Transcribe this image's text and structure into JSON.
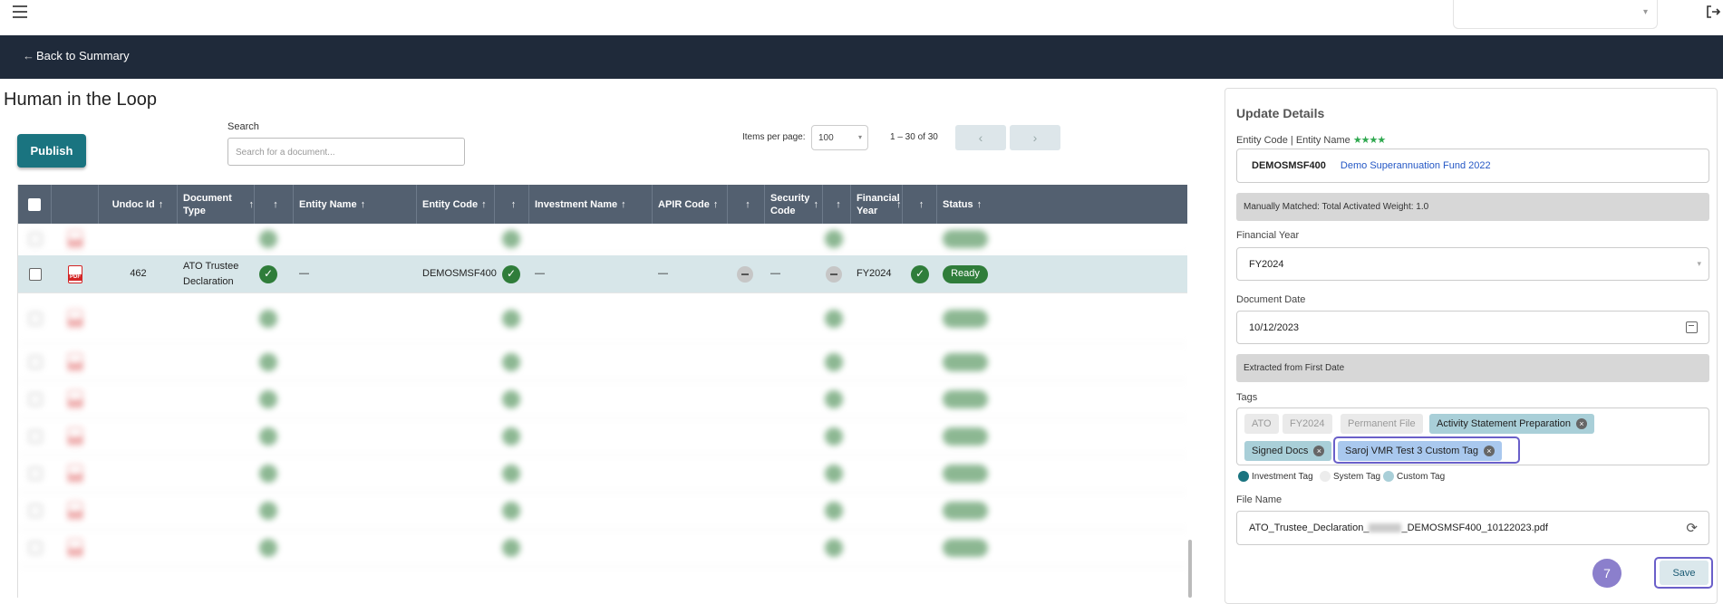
{
  "header": {
    "menu_icon": "hamburger-icon",
    "logout_icon": "logout-icon"
  },
  "nav": {
    "back_label": "Back to Summary"
  },
  "page": {
    "title": "Human in the Loop"
  },
  "toolbar": {
    "publish_label": "Publish",
    "search_label": "Search",
    "search_placeholder": "Search for a document...",
    "items_per_page_label": "Items per page:",
    "items_per_page_value": "100",
    "range_text": "1 – 30 of 30",
    "prev_icon": "‹",
    "next_icon": "›"
  },
  "table": {
    "columns": {
      "undoc_id": "Undoc Id",
      "document_type": "Document Type",
      "entity_name": "Entity Name",
      "entity_code": "Entity Code",
      "investment_name": "Investment Name",
      "apir_code": "APIR Code",
      "security_code": "Security Code",
      "financial_year": "Financial Year",
      "status": "Status"
    },
    "sort_arrow": "↑",
    "active_row": {
      "undoc_id": "462",
      "document_type": "ATO Trustee Declaration",
      "entity_name": "—",
      "entity_code": "DEMOSMSF400",
      "investment_name": "—",
      "apir_code": "—",
      "security_code": "—",
      "financial_year": "FY2024",
      "status": "Ready"
    },
    "check_glyph": "✓"
  },
  "details": {
    "title": "Update Details",
    "entity_label": "Entity Code | Entity Name",
    "stars": "★★★★",
    "entity_code": "DEMOSMSF400",
    "entity_name": "Demo Superannuation Fund 2022",
    "match_note": "Manually Matched: Total Activated Weight: 1.0",
    "fy_label": "Financial Year",
    "fy_value": "FY2024",
    "doc_date_label": "Document Date",
    "doc_date_value": "10/12/2023",
    "date_note": "Extracted from First Date",
    "tags_label": "Tags",
    "tags": {
      "ato": "ATO",
      "fy": "FY2024",
      "permanent": "Permanent File",
      "activity": "Activity Statement Preparation",
      "signed": "Signed Docs",
      "custom": "Saroj VMR Test 3 Custom Tag"
    },
    "legend": {
      "investment": "Investment Tag",
      "system": "System Tag",
      "custom": "Custom Tag"
    },
    "file_name_label": "File Name",
    "file_name_prefix": "ATO_Trustee_Declaration_",
    "file_name_suffix": "_DEMOSMSF400_10122023.pdf",
    "step_number": "7",
    "save_label": "Save"
  },
  "colors": {
    "navbar": "#1f2a3a",
    "publish": "#1a7480",
    "investment_tag": "#a9cfd8",
    "custom_tag": "#a9c8ee",
    "highlight": "#6a5fc9",
    "ready": "#2f7d3a"
  }
}
